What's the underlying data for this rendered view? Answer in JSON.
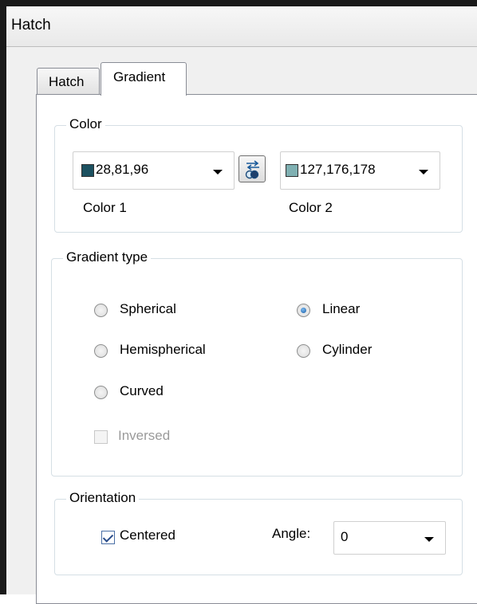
{
  "window": {
    "title": "Hatch"
  },
  "tabs": [
    {
      "label": "Hatch",
      "active": false
    },
    {
      "label": "Gradient",
      "active": true
    }
  ],
  "color_group": {
    "legend": "Color",
    "color1": {
      "value": "28,81,96",
      "swatch": "#1c5160",
      "caption": "Color 1"
    },
    "color2": {
      "value": "127,176,178",
      "swatch": "#7fb0b2",
      "caption": "Color 2"
    },
    "swap_icon": "swap-colors-icon"
  },
  "gradient_type_group": {
    "legend": "Gradient type",
    "options": {
      "spherical": "Spherical",
      "linear": "Linear",
      "hemispherical": "Hemispherical",
      "cylinder": "Cylinder",
      "curved": "Curved"
    },
    "selected": "Linear",
    "inversed": {
      "label": "Inversed",
      "checked": false,
      "enabled": false
    }
  },
  "orientation_group": {
    "legend": "Orientation",
    "centered": {
      "label": "Centered",
      "checked": true
    },
    "angle": {
      "label": "Angle:",
      "value": "0"
    }
  }
}
